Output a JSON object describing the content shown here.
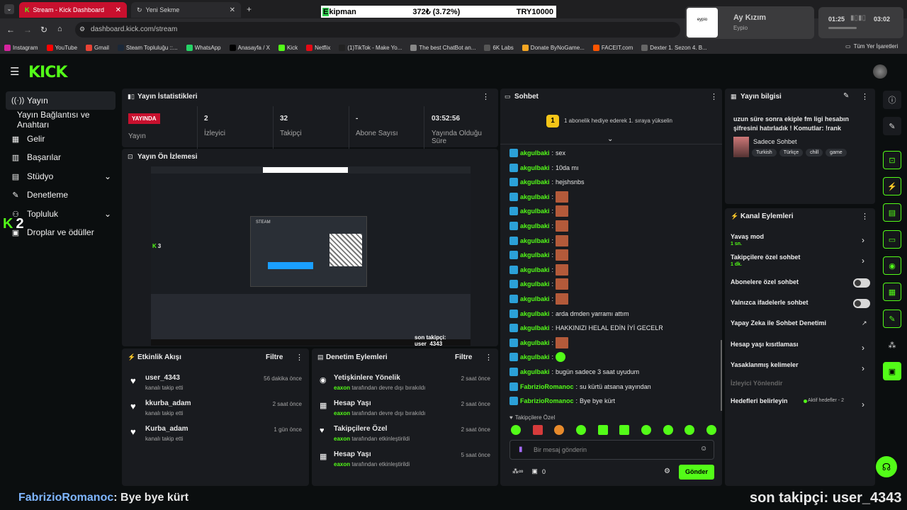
{
  "browser": {
    "tabs": [
      {
        "title": "Stream - Kick Dashboard"
      },
      {
        "title": "Yeni Sekme"
      }
    ],
    "url": "dashboard.kick.com/stream",
    "bookmarks": [
      "Instagram",
      "YouTube",
      "Gmail",
      "Steam Topluluğu ::...",
      "WhatsApp",
      "Anasayfa / X",
      "Kick",
      "Netflix",
      "(1)TikTok - Make Yo...",
      "The best ChatBot an...",
      "6K Labs",
      "Donate ByNoGame...",
      "FACEIT.com",
      "Dexter 1. Sezon 4. B..."
    ],
    "all_bookmarks": "Tüm Yer İşaretleri"
  },
  "ticker": {
    "name_first": "E",
    "name_rest": "kipman",
    "price": "372₺ (3.72%)",
    "goal": "TRY10000"
  },
  "music": {
    "title": "Ay Kızım",
    "artist": "Eypio",
    "art_text": "eypio",
    "elapsed": "01:25",
    "total": "03:02"
  },
  "sidebar": {
    "items": [
      {
        "label": "Yayın",
        "icon": "broadcast-icon"
      },
      {
        "label": "Yayın Bağlantısı ve Anahtarı",
        "icon": ""
      },
      {
        "label": "Gelir",
        "icon": "revenue-icon"
      },
      {
        "label": "Başarılar",
        "icon": "achievements-icon"
      },
      {
        "label": "Stüdyo",
        "icon": "studio-icon"
      },
      {
        "label": "Denetleme",
        "icon": "wrench-icon"
      },
      {
        "label": "Topluluk",
        "icon": "community-icon"
      },
      {
        "label": "Droplar ve ödüller",
        "icon": "drops-icon"
      }
    ],
    "overlay_count": "2"
  },
  "stats": {
    "title": "Yayın İstatistikleri",
    "live_badge": "YAYINDA",
    "cells": [
      {
        "value": "",
        "label": "Yayın"
      },
      {
        "value": "2",
        "label": "İzleyici"
      },
      {
        "value": "32",
        "label": "Takipçi"
      },
      {
        "value": "-",
        "label": "Abone Sayısı"
      },
      {
        "value": "03:52:56",
        "label": "Yayında Olduğu Süre"
      }
    ]
  },
  "preview": {
    "title": "Yayın Ön İzlemesi",
    "overlay_text": "son takipçi: user_4343",
    "counter": "3"
  },
  "activity": {
    "title": "Etkinlik Akışı",
    "filter": "Filtre",
    "items": [
      {
        "name": "user_4343",
        "sub": "kanalı takip etti",
        "time": "56 dakika önce"
      },
      {
        "name": "kkurba_adam",
        "sub": "kanalı takip etti",
        "time": "2 saat önce"
      },
      {
        "name": "Kurba_adam",
        "sub": "kanalı takip etti",
        "time": "1 gün önce"
      }
    ]
  },
  "moderation": {
    "title": "Denetim Eylemleri",
    "filter": "Filtre",
    "items": [
      {
        "name": "Yetişkinlere Yönelik",
        "actor": "eaxon",
        "sub": " tarafından devre dışı bırakıldı",
        "time": "2 saat önce",
        "icon": "eye-icon"
      },
      {
        "name": "Hesap Yaşı",
        "actor": "eaxon",
        "sub": " tarafından devre dışı bırakıldı",
        "time": "2 saat önce",
        "icon": "calendar-icon"
      },
      {
        "name": "Takipçilere Özel",
        "actor": "eaxon",
        "sub": " tarafından etkinleştirildi",
        "time": "2 saat önce",
        "icon": "heart-icon"
      },
      {
        "name": "Hesap Yaşı",
        "actor": "eaxon",
        "sub": " tarafından etkinleştirildi",
        "time": "5 saat önce",
        "icon": "calendar-icon"
      }
    ]
  },
  "chat": {
    "title": "Sohbet",
    "banner_rank": "1",
    "banner_text": "1 abonelik hediye ederek 1. sıraya yükselin",
    "messages": [
      {
        "user": "akgulbaki",
        "text": "sex",
        "emote": ""
      },
      {
        "user": "akgulbaki",
        "text": "10da mı",
        "emote": ""
      },
      {
        "user": "akgulbaki",
        "text": "hejshsnbs",
        "emote": ""
      },
      {
        "user": "akgulbaki",
        "text": "",
        "emote": "red"
      },
      {
        "user": "akgulbaki",
        "text": "",
        "emote": "red"
      },
      {
        "user": "akgulbaki",
        "text": "",
        "emote": "red"
      },
      {
        "user": "akgulbaki",
        "text": "",
        "emote": "red"
      },
      {
        "user": "akgulbaki",
        "text": "",
        "emote": "red"
      },
      {
        "user": "akgulbaki",
        "text": "",
        "emote": "red"
      },
      {
        "user": "akgulbaki",
        "text": "",
        "emote": "red"
      },
      {
        "user": "akgulbaki",
        "text": "",
        "emote": "red"
      },
      {
        "user": "akgulbaki",
        "text": "arda dmden yarramı attım",
        "emote": ""
      },
      {
        "user": "akgulbaki",
        "text": "HAKKINIZI HELAL EDİN İYİ GECELR",
        "emote": ""
      },
      {
        "user": "akgulbaki",
        "text": "",
        "emote": "red"
      },
      {
        "user": "akgulbaki",
        "text": "",
        "emote": "green"
      },
      {
        "user": "akgulbaki",
        "text": "bugün sadece 3 saat uyudum",
        "emote": ""
      },
      {
        "user": "FabrizioRomanoc",
        "text": "su kürtü atsana yayından",
        "emote": ""
      },
      {
        "user": "FabrizioRomanoc",
        "text": "Bye bye kürt",
        "emote": ""
      }
    ],
    "followers_only": "Takipçilere Özel",
    "input_placeholder": "Bir mesaj gönderin",
    "points": "0",
    "send": "Gönder"
  },
  "stream_info": {
    "title": "Yayın bilgisi",
    "text": "uzun süre sonra ekiple fm ligi hesabın şifresini hatırladık ! Komutlar: !rank",
    "category": "Sadece Sohbet",
    "tags": [
      "Turkish",
      "Türkçe",
      "chill",
      "game"
    ]
  },
  "channel_actions": {
    "title": "Kanal Eylemleri",
    "items": [
      {
        "label": "Yavaş mod",
        "sub": "1 sn.",
        "control": "chevron"
      },
      {
        "label": "Takipçilere özel sohbet",
        "sub": "1 dk.",
        "control": "chevron"
      },
      {
        "label": "Abonelere özel sohbet",
        "sub": "",
        "control": "toggle"
      },
      {
        "label": "Yalnızca ifadelerle sohbet",
        "sub": "",
        "control": "toggle"
      },
      {
        "label": "Yapay Zeka ile Sohbet Denetimi",
        "sub": "",
        "control": "external"
      },
      {
        "label": "Hesap yaşı kısıtlaması",
        "sub": "",
        "control": "chevron"
      },
      {
        "label": "Yasaklanmış kelimeler",
        "sub": "",
        "control": "chevron"
      },
      {
        "label": "İzleyici Yönlendir",
        "sub": "",
        "control": "none"
      },
      {
        "label": "Hedefleri belirleyin",
        "sub": "",
        "control": "chevron"
      }
    ],
    "goals_status": "Aktif hedefler - 2"
  },
  "bottom_overlay": {
    "left_user": "FabrizioRomanoc",
    "left_msg": ": Bye bye kürt",
    "right_text": "son takipçi: user_4343"
  },
  "colors": {
    "kick_green": "#53fc18",
    "live_red": "#c8102e",
    "panel": "#191b1f",
    "bg": "#0b0e0f"
  }
}
